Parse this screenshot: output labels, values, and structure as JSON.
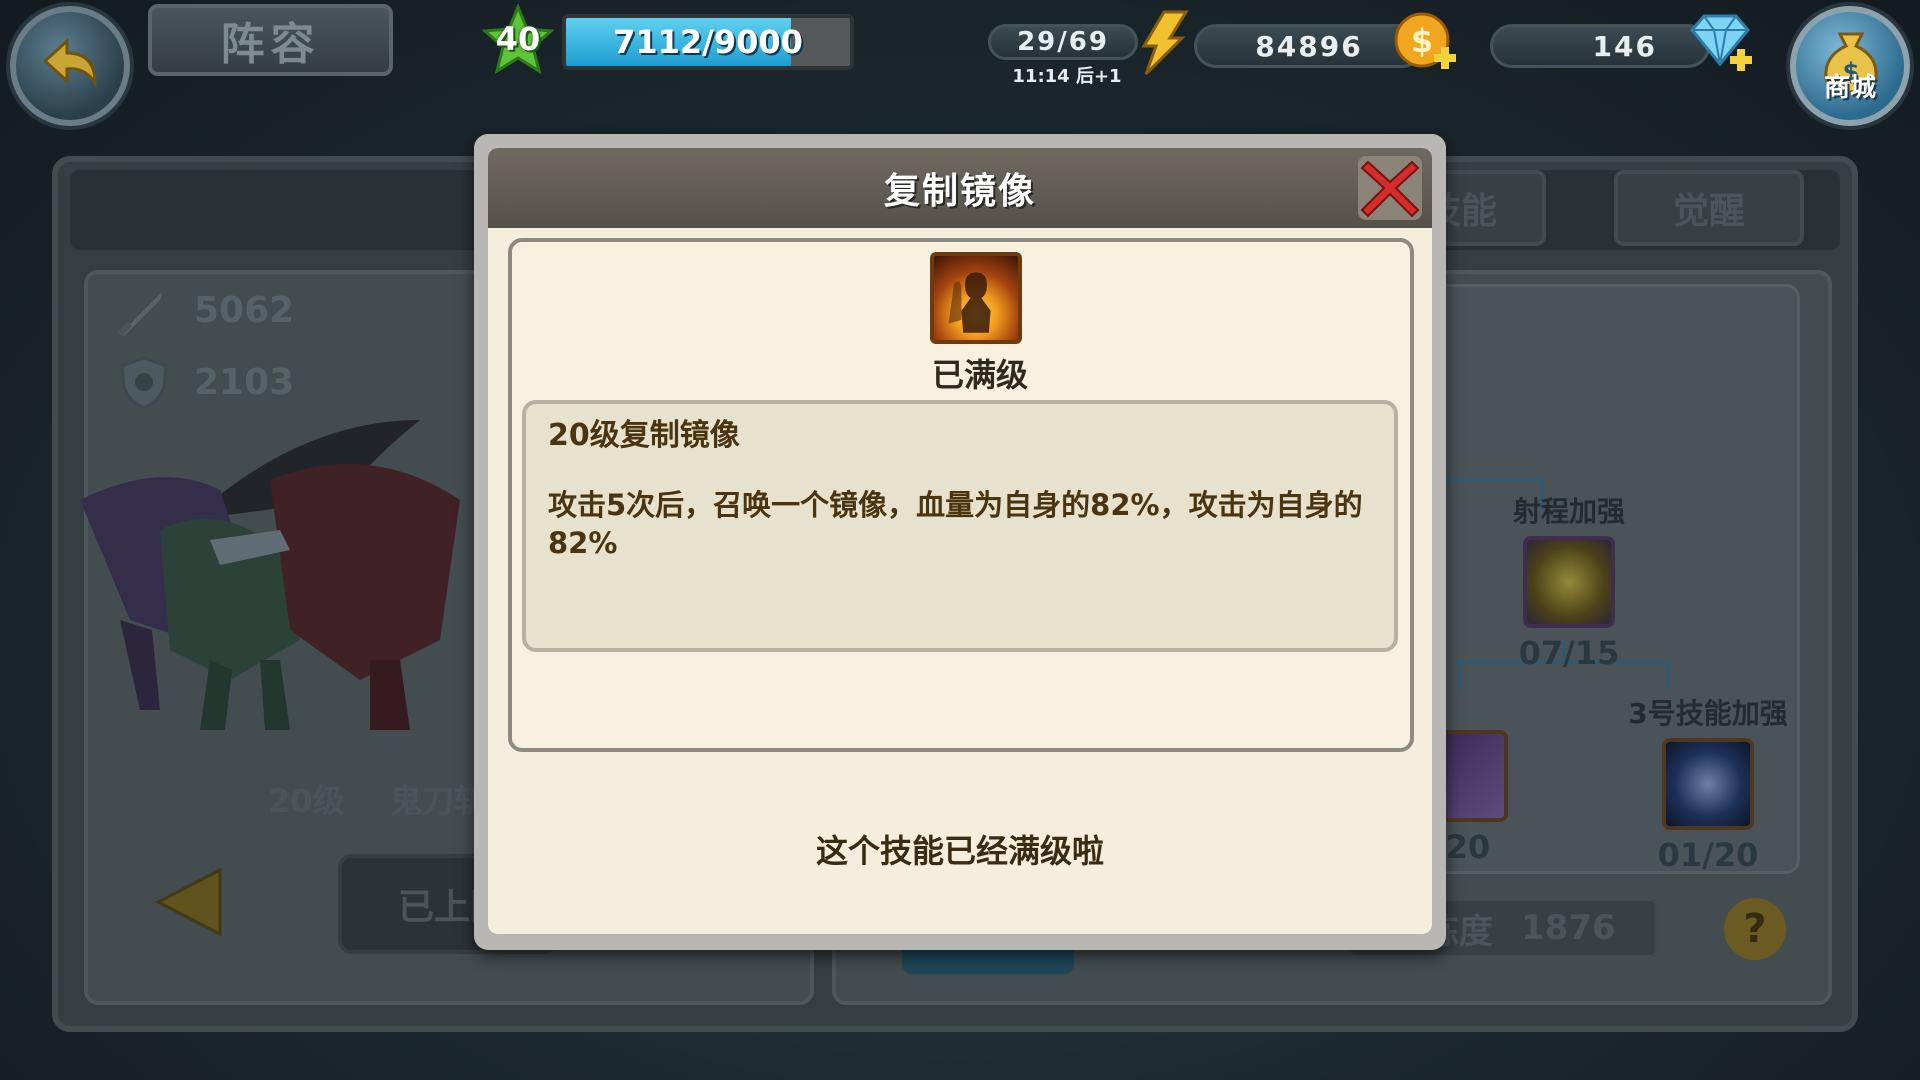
{
  "topbar": {
    "screen_title": "阵容",
    "player_level": "40",
    "exp_text": "7112/9000",
    "exp_fraction": 0.791,
    "stamina": "29/69",
    "stamina_timer": "11:14 后+1",
    "gold": "84896",
    "gems": "146",
    "shop_label": "商城"
  },
  "background": {
    "tab_skill": "技能",
    "tab_awaken": "觉醒",
    "attack_value": "5062",
    "defense_value": "2103",
    "hero_level": "20级",
    "hero_name": "鬼刀斩",
    "deploy_label": "已上阵",
    "skill_tree": {
      "node_range": {
        "label": "射程加强",
        "count": "07/15"
      },
      "node_left": {
        "label": "",
        "count": "/20"
      },
      "node_skill3": {
        "label": "3号技能加强",
        "count": "01/20"
      }
    },
    "points_label": "熟练度",
    "points_value": "1876",
    "help_label": "?"
  },
  "modal": {
    "title": "复制镜像",
    "status": "已满级",
    "desc_title": "20级复制镜像",
    "desc_text": "攻击5次后，召唤一个镜像，血量为自身的82%，攻击为自身的82%",
    "footer": "这个技能已经满级啦"
  },
  "icons": {
    "back": "back-arrow-icon",
    "level": "green-star-icon",
    "stamina": "lightning-icon",
    "gold": "gold-coin-plus-icon",
    "gems": "diamond-plus-icon",
    "shop": "money-bag-icon",
    "close": "red-x-icon"
  },
  "colors": {
    "exp_fill": "#1e9cd0",
    "modal_bg": "#f5eedc",
    "modal_header": "#5f5c54",
    "close_red": "#d42b2b",
    "desc_text": "#4a3510"
  }
}
